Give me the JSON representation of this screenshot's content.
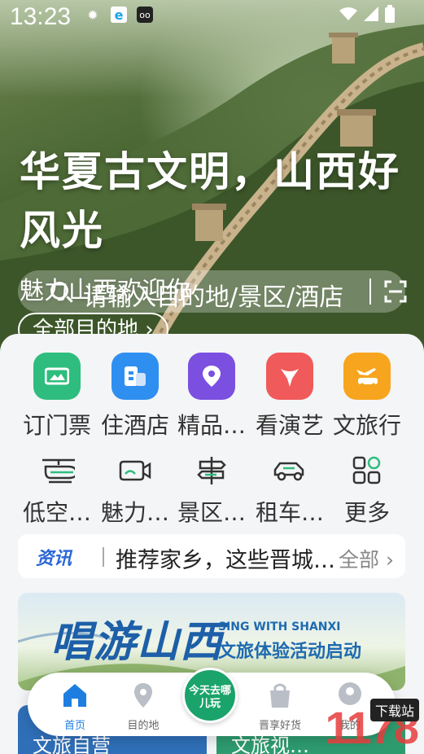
{
  "status_bar": {
    "time": "13:23"
  },
  "hero": {
    "title": "华夏古文明，山西好风光",
    "subtitle": "魅力山西欢迎你",
    "search_placeholder": "请输入目的地/景区/酒店",
    "all_destinations": "全部目的地 ›"
  },
  "quick_entries": [
    {
      "label": "订门票",
      "icon": "ticket-icon",
      "color": "#2ebd7e"
    },
    {
      "label": "住酒店",
      "icon": "hotel-icon",
      "color": "#2f8ff0"
    },
    {
      "label": "精品…",
      "icon": "location-pin-icon",
      "color": "#7b4fe0"
    },
    {
      "label": "看演艺",
      "icon": "performance-icon",
      "color": "#f05a5a"
    },
    {
      "label": "文旅行",
      "icon": "car-plane-icon",
      "color": "#f7a51e"
    }
  ],
  "secondary_entries": [
    {
      "label": "低空…",
      "icon": "helicopter-icon"
    },
    {
      "label": "魅力…",
      "icon": "video-camera-icon"
    },
    {
      "label": "景区…",
      "icon": "signpost-icon"
    },
    {
      "label": "租车…",
      "icon": "car-icon"
    },
    {
      "label": "更多",
      "icon": "grid-more-icon"
    }
  ],
  "news": {
    "tag": "资讯",
    "headline": "推荐家乡，这些晋城…",
    "all": "全部 ›"
  },
  "banner": {
    "title": "唱游山西",
    "subtitle_en": "SING WITH SHANXI",
    "subtitle_cn": "文旅体验活动启动"
  },
  "lower_cards": [
    {
      "label": "文旅自营"
    },
    {
      "label": "文旅视…"
    }
  ],
  "tab_bar": {
    "items": [
      {
        "label": "首页",
        "icon": "home-icon",
        "active": true
      },
      {
        "label": "目的地",
        "icon": "map-pin-icon",
        "active": false
      },
      {
        "label": "晋享好货",
        "icon": "shopping-bag-icon",
        "active": false
      },
      {
        "label": "我的",
        "icon": "profile-icon",
        "active": false
      }
    ],
    "center_button": "今天去哪儿玩"
  },
  "watermark": {
    "number": "1178",
    "tag": "下载站"
  }
}
